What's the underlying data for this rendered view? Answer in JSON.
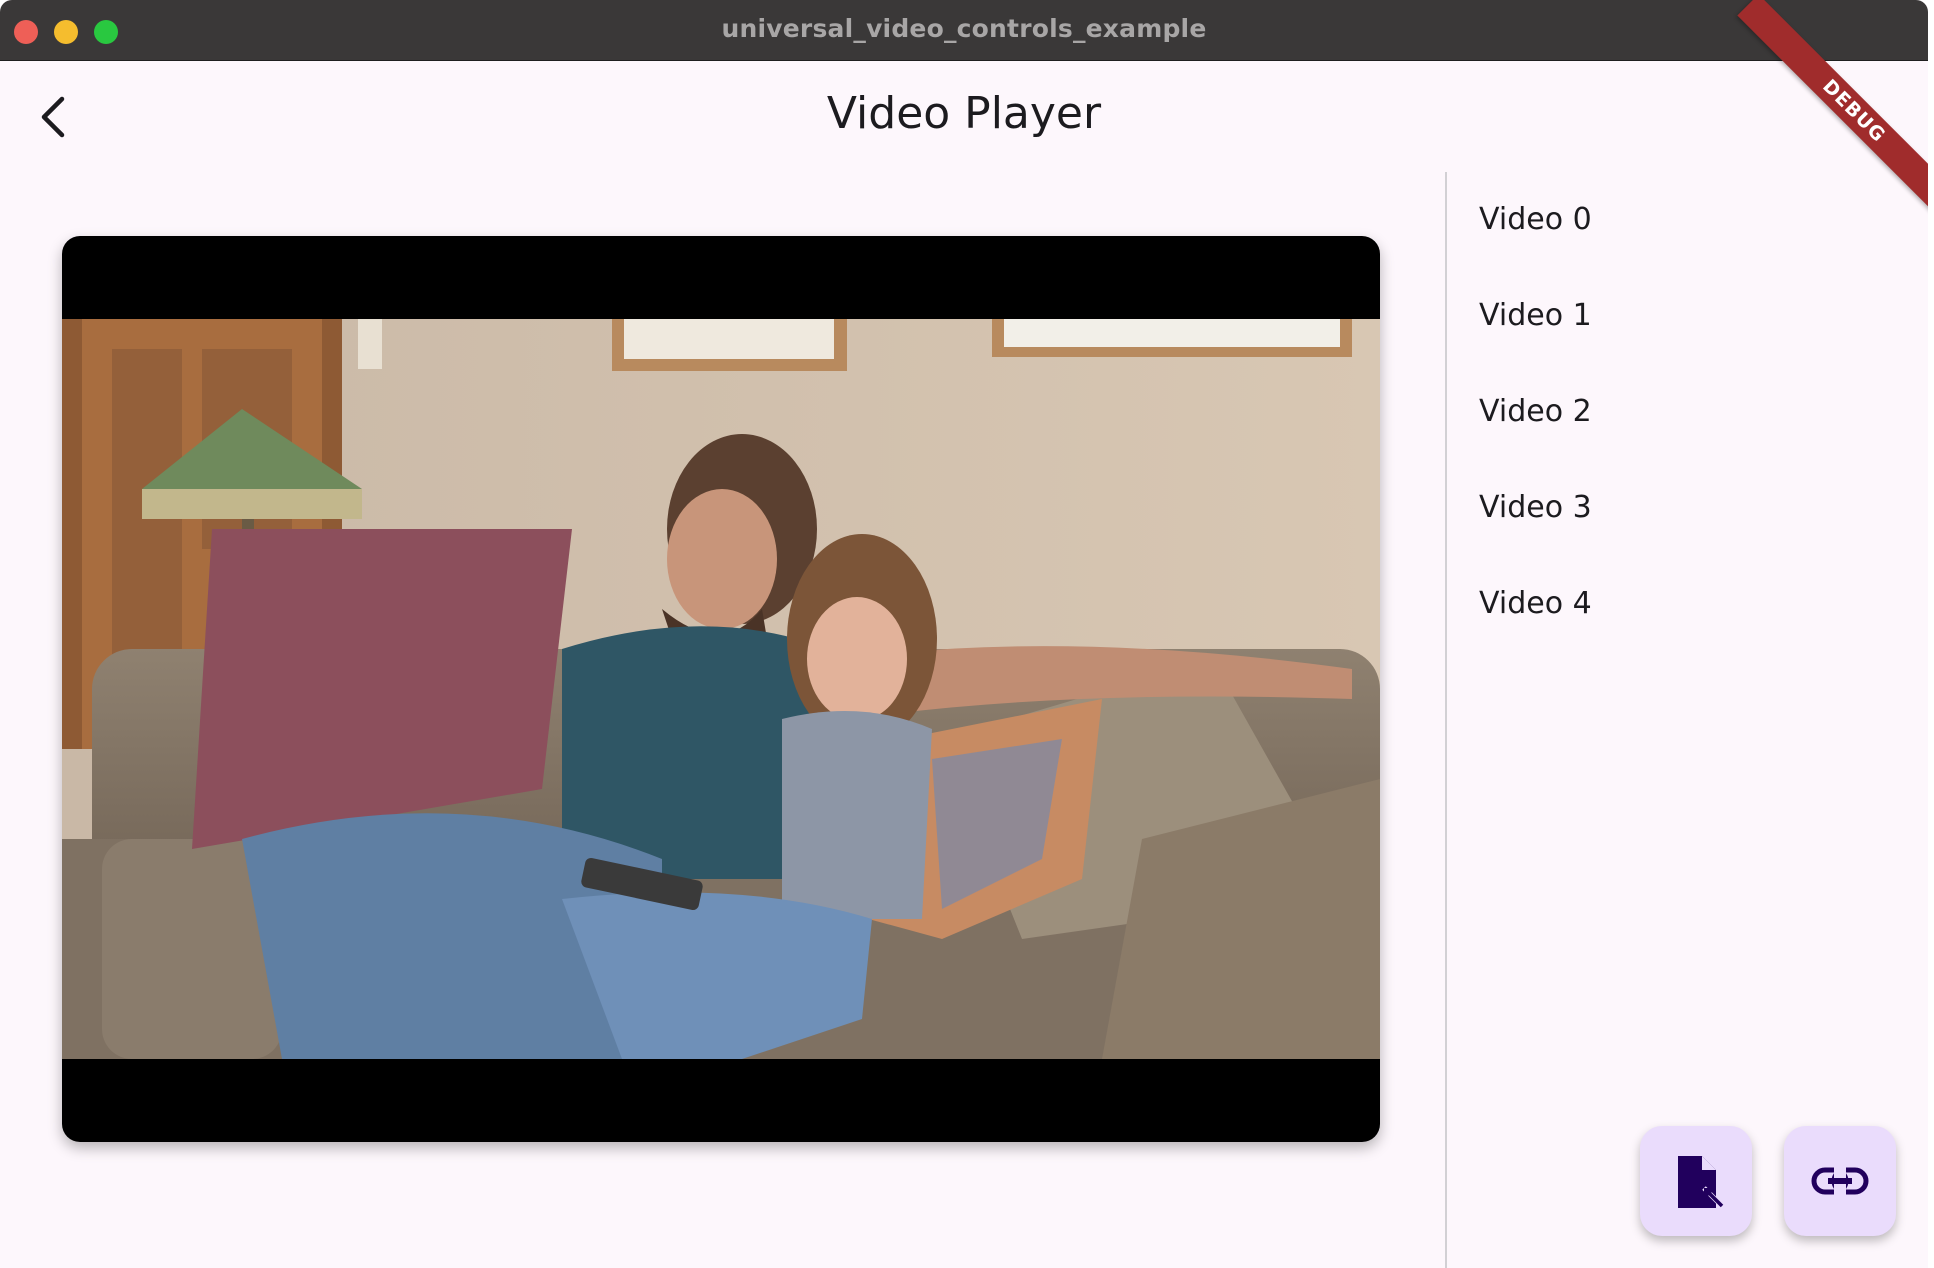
{
  "window": {
    "title": "universal_video_controls_example"
  },
  "appbar": {
    "title": "Video Player",
    "back_icon": "chevron-left-icon"
  },
  "debug_banner": "DEBUG",
  "player": {
    "scene": "video-frame"
  },
  "playlist": {
    "items": [
      {
        "label": "Video 0"
      },
      {
        "label": "Video 1"
      },
      {
        "label": "Video 2"
      },
      {
        "label": "Video 3"
      },
      {
        "label": "Video 4"
      }
    ]
  },
  "actions": {
    "open_file_icon": "file-open-icon",
    "open_url_icon": "link-icon"
  },
  "colors": {
    "background": "#fdf7fc",
    "fab": "#eadcfc",
    "fab_icon": "#21005d",
    "debug": "#a02c2c"
  }
}
